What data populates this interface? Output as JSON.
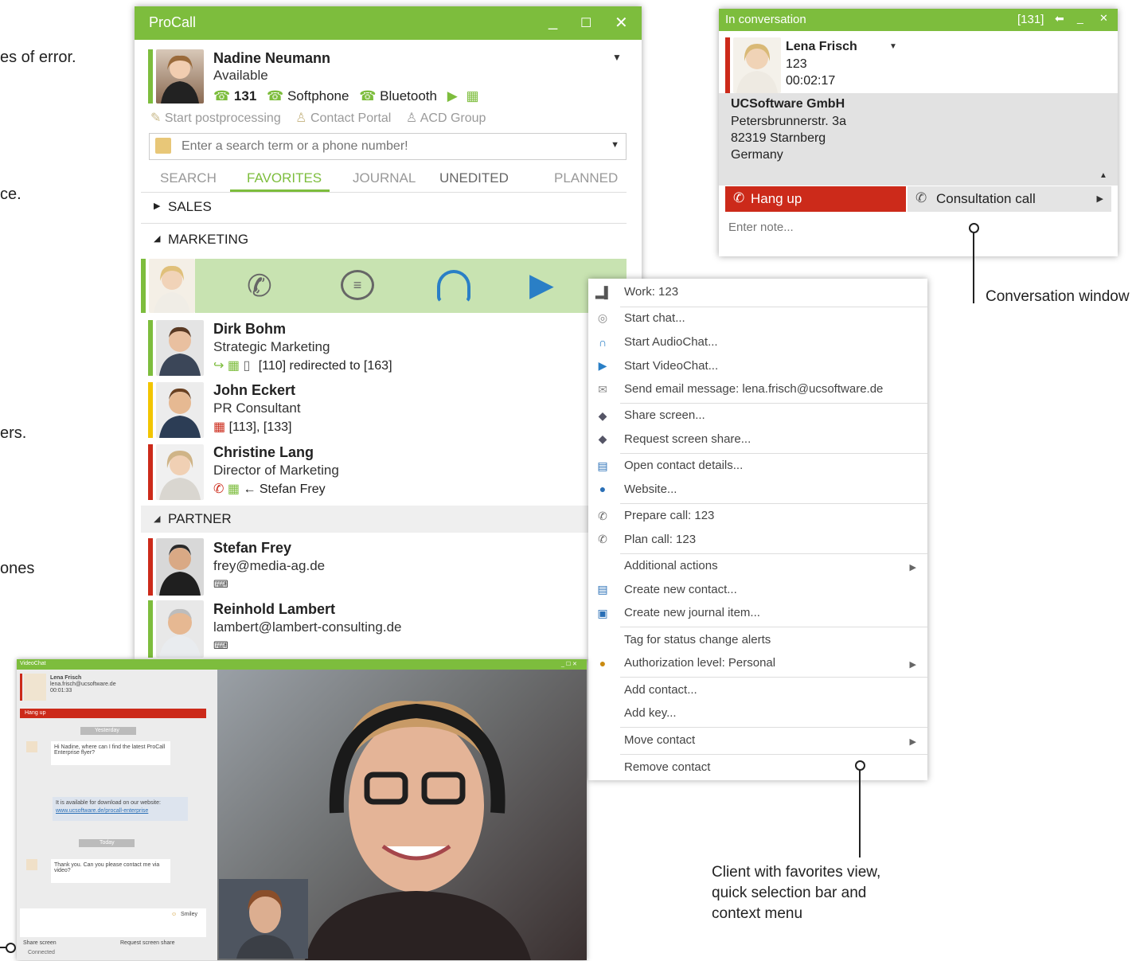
{
  "side_texts": [
    "es of error.",
    "ce.",
    "ers.",
    "ones"
  ],
  "main": {
    "title": "ProCall",
    "user": {
      "name": "Nadine Neumann",
      "status": "Available",
      "number": "131",
      "softphone": "Softphone",
      "bluetooth": "Bluetooth"
    },
    "actions": [
      "Start postprocessing",
      "Contact Portal",
      "ACD Group"
    ],
    "search": {
      "placeholder": "Enter a search term or a phone number!"
    },
    "tabs": [
      "SEARCH",
      "FAVORITES",
      "JOURNAL",
      "UNEDITED",
      "PLANNED"
    ],
    "groups": {
      "sales": "SALES",
      "marketing": "MARKETING",
      "partner": "PARTNER"
    },
    "contacts": [
      {
        "name": "Dirk Bohm",
        "title": "Strategic Marketing",
        "info": "[110] redirected to [163]"
      },
      {
        "name": "John Eckert",
        "title": "PR Consultant",
        "info": "[113], [133]"
      },
      {
        "name": "Christine Lang",
        "title": "Director of Marketing",
        "info": "← Stefan Frey"
      },
      {
        "name": "Stefan Frey",
        "title": "frey@media-ag.de",
        "info": ""
      },
      {
        "name": "Reinhold Lambert",
        "title": "lambert@lambert-consulting.de",
        "info": ""
      }
    ]
  },
  "conversation": {
    "title": "In conversation",
    "number_badge": "[131]",
    "contact_name": "Lena Frisch",
    "contact_number": "123",
    "duration": "00:02:17",
    "company": "UCSoftware GmbH",
    "street": "Petersbrunnerstr. 3a",
    "city": "82319 Starnberg",
    "country": "Germany",
    "hangup_label": "Hang up",
    "consult_label": "Consultation call",
    "note_placeholder": "Enter note..."
  },
  "context_menu": {
    "items": [
      "Work: 123",
      "Start chat...",
      "Start AudioChat...",
      "Start VideoChat...",
      "Send email message: lena.frisch@ucsoftware.de",
      "Share screen...",
      "Request screen share...",
      "Open contact details...",
      "Website...",
      "Prepare call: 123",
      "Plan call: 123",
      "Additional actions",
      "Create new contact...",
      "Create new journal item...",
      "Tag for status change alerts",
      "Authorization level: Personal",
      "Add contact...",
      "Add key...",
      "Move contact",
      "Remove contact"
    ]
  },
  "captions": {
    "conversation_window": "Conversation window",
    "client_line1": "Client with favorites view,",
    "client_line2": "quick selection bar and",
    "client_line3": "context menu"
  },
  "video_chat": {
    "title": "VideoChat",
    "contact_name": "Lena Frisch",
    "contact_email": "lena.frisch@ucsoftware.de",
    "duration": "00:01:33",
    "hangup": "Hang up",
    "yesterday": "Yesterday",
    "msg1": "Hi Nadine, where can I find the latest ProCall Enterprise flyer?",
    "msg2": "It is available for download on our website:",
    "msg2_link": "www.ucsoftware.de/procall-enterprise",
    "today": "Today",
    "msg3": "Thank you. Can you please contact me via video?",
    "smiley": "Smiley",
    "share_screen": "Share screen",
    "request_share": "Request screen share",
    "status": "Connected"
  }
}
